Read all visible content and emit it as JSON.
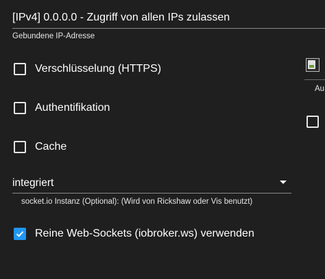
{
  "bind": {
    "value": "[IPv4] 0.0.0.0 - Zugriff von allen IPs zulassen",
    "helper": "Gebundene IP-Adresse"
  },
  "options": {
    "https": {
      "label": "Verschlüsselung (HTTPS)",
      "checked": false
    },
    "auth": {
      "label": "Authentifikation",
      "checked": false
    },
    "cache": {
      "label": "Cache",
      "checked": false
    },
    "pure_ws": {
      "label": "Reine Web-Sockets (iobroker.ws) verwenden",
      "checked": true
    }
  },
  "socketio": {
    "value": "integriert",
    "helper": "socket.io Instanz (Optional): (Wird von Rickshaw oder Vis benutzt)"
  },
  "right_column": {
    "label_partial": "Au"
  },
  "colors": {
    "background": "#1f1f1f",
    "accent": "#2196f3"
  }
}
